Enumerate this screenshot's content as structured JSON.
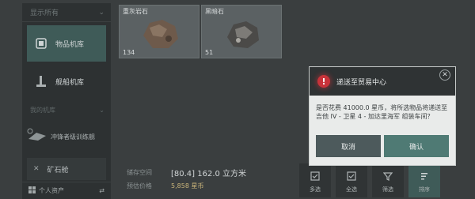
{
  "sidebar": {
    "header": "显示所有",
    "items": [
      {
        "label": "物品机库",
        "icon": "cube-icon"
      },
      {
        "label": "舰船机库",
        "icon": "ship-icon"
      }
    ],
    "sub_header": "我的机库",
    "station_name": "冲锋者级训练舰",
    "ore_label": "矿石舱",
    "footer_label": "个人资产"
  },
  "cards": [
    {
      "name": "重灰岩石",
      "qty": "134"
    },
    {
      "name": "黑暗石",
      "qty": "51"
    }
  ],
  "info": {
    "storage_label": "储存空间",
    "storage_value": "[80.4] 162.0 立方米",
    "price_label": "预估价格",
    "price_value": "5,858 星币"
  },
  "actions": [
    {
      "label": "多选",
      "icon": "checkbox-icon"
    },
    {
      "label": "全选",
      "icon": "checkbox-icon"
    },
    {
      "label": "筛选",
      "icon": "filter-icon"
    },
    {
      "label": "排序",
      "icon": "sort-icon"
    }
  ],
  "dialog": {
    "title": "递送至贸易中心",
    "body": "是否花费 41000.0 星币，将所选物品将递送至吉他 IV - 卫星 4 - 加达里海军 组装车间？",
    "cancel": "取消",
    "confirm": "确认"
  },
  "colors": {
    "accent": "#3f5b58",
    "warning": "#c8333a",
    "confirm": "#4f7a74"
  }
}
